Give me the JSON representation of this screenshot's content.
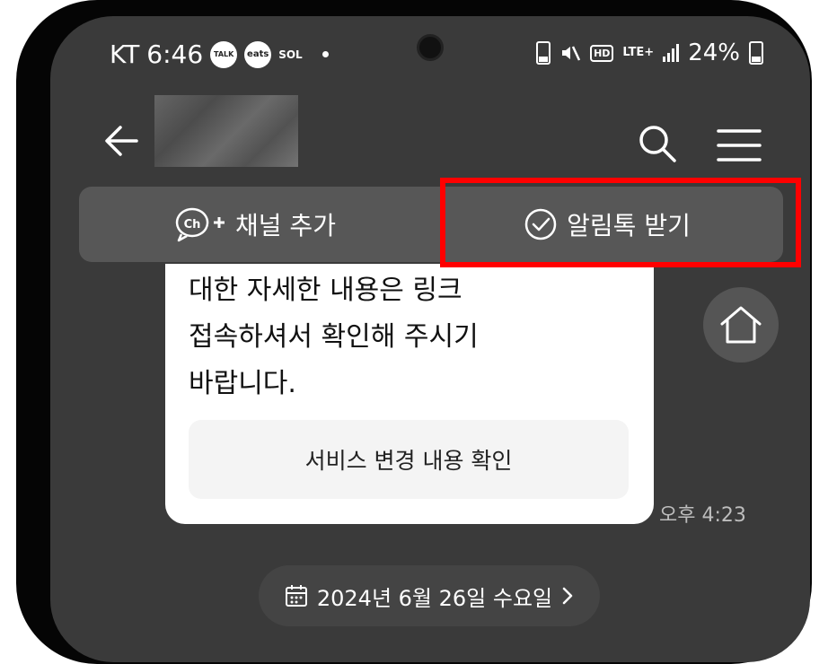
{
  "status_bar": {
    "carrier": "KT",
    "time": "6:46",
    "notifications": [
      "TALK",
      "eats",
      "SOL"
    ],
    "network": "LTE+",
    "battery": "24%"
  },
  "header": {
    "channel_name": "",
    "icons": [
      "back-arrow-icon",
      "search-icon",
      "hamburger-menu-icon"
    ]
  },
  "action_bar": {
    "add_channel_label": "채널 추가",
    "receive_alimtalk_label": "알림톡 받기"
  },
  "message": {
    "lines": [
      "대한 자세한 내용은 링크",
      "접속하셔서 확인해 주시기",
      "바랍니다."
    ],
    "button_label": "서비스 변경 내용 확인",
    "time": "오후 4:23"
  },
  "date_divider": {
    "label": "2024년 6월 26일 수요일"
  },
  "colors": {
    "background": "#3a3a3a",
    "action_bar": "#575757",
    "highlight": "#ff0000",
    "bubble": "#ffffff"
  }
}
